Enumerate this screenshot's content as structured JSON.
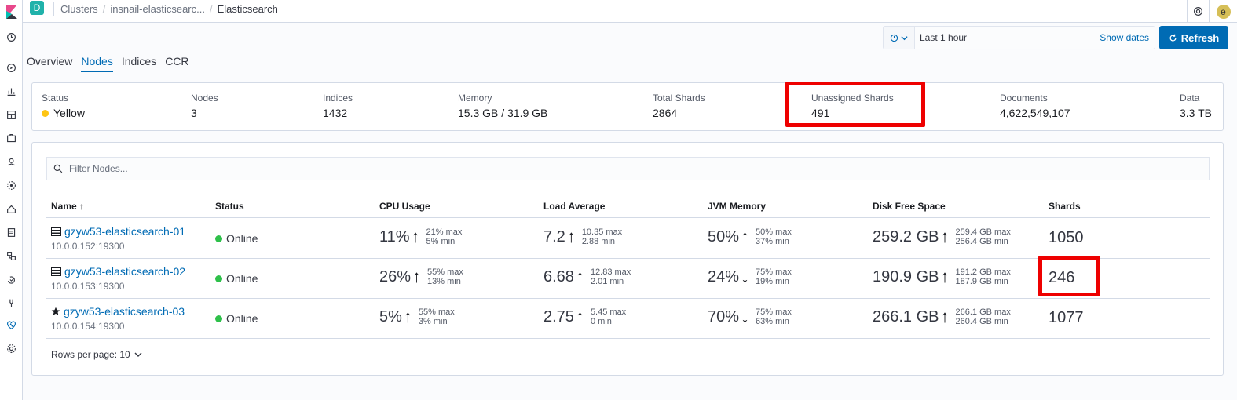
{
  "header": {
    "space_initial": "D",
    "breadcrumbs": [
      "Clusters",
      "insnail-elasticsearc...",
      "Elasticsearch"
    ],
    "avatar_initial": "e"
  },
  "datepicker": {
    "range": "Last 1 hour",
    "show_dates": "Show dates",
    "refresh": "Refresh"
  },
  "tabs": [
    "Overview",
    "Nodes",
    "Indices",
    "CCR"
  ],
  "summary": {
    "status_label": "Status",
    "status_value": "Yellow",
    "nodes_label": "Nodes",
    "nodes_value": "3",
    "indices_label": "Indices",
    "indices_value": "1432",
    "memory_label": "Memory",
    "memory_value": "15.3 GB / 31.9 GB",
    "total_shards_label": "Total Shards",
    "total_shards_value": "2864",
    "unassigned_label": "Unassigned Shards",
    "unassigned_value": "491",
    "documents_label": "Documents",
    "documents_value": "4,622,549,107",
    "data_label": "Data",
    "data_value": "3.3 TB"
  },
  "filter": {
    "placeholder": "Filter Nodes..."
  },
  "columns": [
    "Name ↑",
    "Status",
    "CPU Usage",
    "Load Average",
    "JVM Memory",
    "Disk Free Space",
    "Shards"
  ],
  "rows": [
    {
      "name": "gzyw53-elasticsearch-01",
      "addr": "10.0.0.152:19300",
      "status": "Online",
      "cpu": "11%",
      "cpu_max": "21% max",
      "cpu_min": "5% min",
      "load": "7.2",
      "load_max": "10.35 max",
      "load_min": "2.88 min",
      "jvm": "50%",
      "jvm_max": "50% max",
      "jvm_min": "37% min",
      "disk": "259.2 GB",
      "disk_max": "259.4 GB max",
      "disk_min": "256.4 GB min",
      "shards": "1050"
    },
    {
      "name": "gzyw53-elasticsearch-02",
      "addr": "10.0.0.153:19300",
      "status": "Online",
      "cpu": "26%",
      "cpu_max": "55% max",
      "cpu_min": "13% min",
      "load": "6.68",
      "load_max": "12.83 max",
      "load_min": "2.01 min",
      "jvm": "24%",
      "jvm_max": "75% max",
      "jvm_min": "19% min",
      "disk": "190.9 GB",
      "disk_max": "191.2 GB max",
      "disk_min": "187.9 GB min",
      "shards": "246"
    },
    {
      "name": "gzyw53-elasticsearch-03",
      "addr": "10.0.0.154:19300",
      "status": "Online",
      "cpu": "5%",
      "cpu_max": "55% max",
      "cpu_min": "3% min",
      "load": "2.75",
      "load_max": "5.45 max",
      "load_min": "0 min",
      "jvm": "70%",
      "jvm_max": "75% max",
      "jvm_min": "63% min",
      "disk": "266.1 GB",
      "disk_max": "266.1 GB max",
      "disk_min": "260.4 GB min",
      "shards": "1077"
    }
  ],
  "pagination": {
    "rows_per_page": "Rows per page: 10"
  },
  "colors": {
    "accent": "#006bb4",
    "yellow": "#fec514",
    "green": "#2ec04a",
    "highlight": "#ee0000"
  }
}
